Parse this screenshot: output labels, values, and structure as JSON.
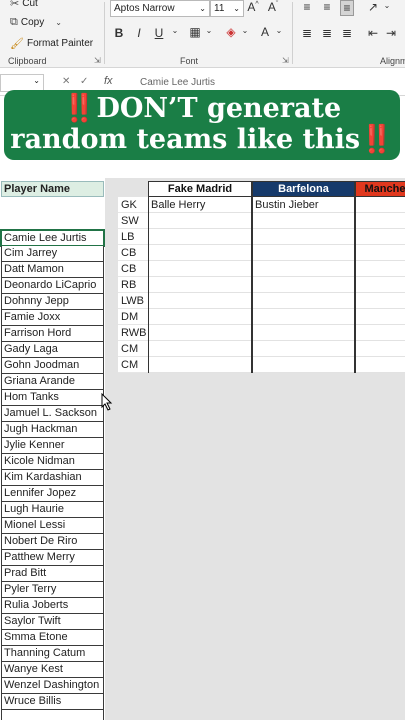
{
  "ribbon": {
    "clipboard": {
      "cut": "Cut",
      "copy": "Copy",
      "format_painter": "Format Painter",
      "title": "Clipboard"
    },
    "font": {
      "font_name": "Aptos Narrow",
      "font_size": "11",
      "title": "Font"
    },
    "alignment": {
      "title": "Alignm"
    }
  },
  "formula_bar": {
    "fx": "fx",
    "value": "Camie Lee Jurtis"
  },
  "banner": {
    "line1_text": "DON’T generate",
    "line2_text": "random teams like this",
    "emoji": "‼️"
  },
  "sheet": {
    "player_header": "Player Name",
    "players": [
      "Camie Lee Jurtis",
      "Cim Jarrey",
      "Datt Mamon",
      "Deonardo LiCaprio",
      "Dohnny Jepp",
      "Famie Joxx",
      "Farrison Hord",
      "Gady Laga",
      "Gohn Joodman",
      "Griana Arande",
      "Hom Tanks",
      "Jamuel L. Sackson",
      "Jugh Hackman",
      "Jylie Kenner",
      "Kicole Nidman",
      "Kim Kardashian",
      "Lennifer Jopez",
      "Lugh Haurie",
      "Mionel Lessi",
      "Nobert De Riro",
      "Patthew Merry",
      "Prad Bitt",
      "Pyler Terry",
      "Rulia Joberts",
      "Saylor Twift",
      "Smma Etone",
      "Thanning Catum",
      "Wanye Kest",
      "Wenzel Dashington",
      "Wruce Billis"
    ],
    "positions": [
      "GK",
      "SW",
      "LB",
      "CB",
      "CB",
      "RB",
      "LWB",
      "DM",
      "RWB",
      "CM",
      "CM"
    ],
    "teams": [
      {
        "name": "Fake Madrid",
        "color": "#ffffff",
        "text_color": "#111111",
        "players": [
          "Balle Herry"
        ]
      },
      {
        "name": "Barfelona",
        "color": "#163a6b",
        "text_color": "#ffffff",
        "players": [
          "Bustin Jieber"
        ]
      },
      {
        "name": "Manche",
        "color": "#e0381e",
        "text_color": "#111111",
        "players": []
      }
    ]
  }
}
